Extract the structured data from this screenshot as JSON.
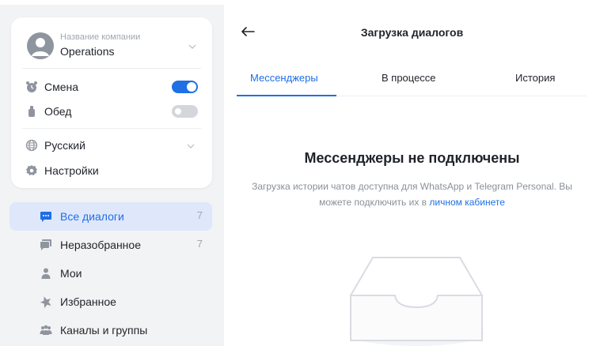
{
  "sidebar": {
    "company": {
      "subtitle": "Название компании",
      "name": "Operations"
    },
    "toggles": [
      {
        "label": "Смена",
        "state": "on"
      },
      {
        "label": "Обед",
        "state": "off"
      }
    ],
    "language": {
      "label": "Русский"
    },
    "settings": {
      "label": "Настройки"
    },
    "nav": [
      {
        "label": "Все диалоги",
        "count": "7",
        "active": true,
        "icon": "chat-bubble-icon"
      },
      {
        "label": "Неразобранное",
        "count": "7",
        "active": false,
        "icon": "chat-stack-icon"
      },
      {
        "label": "Мои",
        "count": "",
        "active": false,
        "icon": "person-icon"
      },
      {
        "label": "Избранное",
        "count": "",
        "active": false,
        "icon": "star-icon"
      },
      {
        "label": "Каналы и группы",
        "count": "",
        "active": false,
        "icon": "group-icon"
      }
    ]
  },
  "main": {
    "title": "Загрузка диалогов",
    "tabs": [
      {
        "label": "Мессенджеры",
        "active": true
      },
      {
        "label": "В процессе",
        "active": false
      },
      {
        "label": "История",
        "active": false
      }
    ],
    "empty": {
      "title": "Мессенджеры не подключены",
      "text": "Загрузка истории чатов доступна для WhatsApp и Telegram Personal. Вы можете подключить их в",
      "link": "личном кабинете"
    }
  },
  "colors": {
    "accent": "#1f6fe5",
    "active_bg": "#dfe7fb",
    "page_bg": "#f2f3f5",
    "muted": "#a2a7b0"
  }
}
